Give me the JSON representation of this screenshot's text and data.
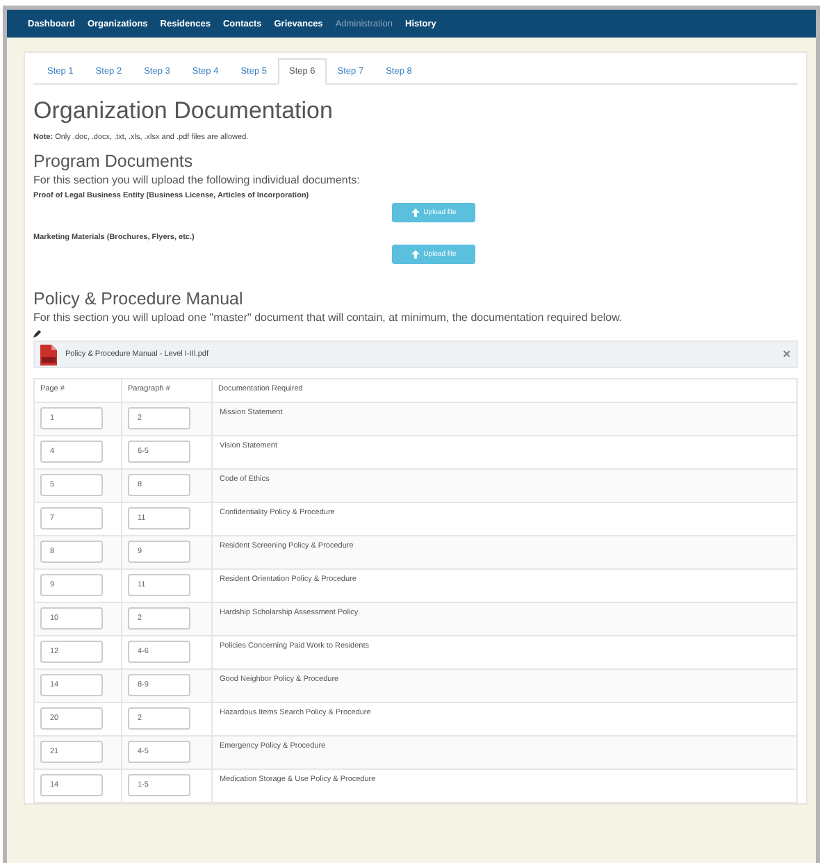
{
  "nav": [
    {
      "label": "Dashboard",
      "disabled": false
    },
    {
      "label": "Organizations",
      "disabled": false
    },
    {
      "label": "Residences",
      "disabled": false
    },
    {
      "label": "Contacts",
      "disabled": false
    },
    {
      "label": "Grievances",
      "disabled": false
    },
    {
      "label": "Administration",
      "disabled": true
    },
    {
      "label": "History",
      "disabled": false
    }
  ],
  "tabs": [
    {
      "label": "Step 1",
      "selected": false
    },
    {
      "label": "Step 2",
      "selected": false
    },
    {
      "label": "Step 3",
      "selected": false
    },
    {
      "label": "Step 4",
      "selected": false
    },
    {
      "label": "Step 5",
      "selected": false
    },
    {
      "label": "Step 6",
      "selected": true
    },
    {
      "label": "Step 7",
      "selected": false
    },
    {
      "label": "Step 8",
      "selected": false
    }
  ],
  "title": "Organization Documentation",
  "note": "**Note:** Only .doc, .docx, .txt, .xls, .xlsx and .pdf files are allowed.",
  "program_documents": {
    "heading": "Program Documents",
    "intro": "For this section you will upload the following individual documents:",
    "items": [
      {
        "label": "Proof of Legal Business Entity (Business License, Articles of Incorporation)",
        "button": "Upload file"
      },
      {
        "label": "Marketing Materials (Brochures, Flyers, etc.)",
        "button": "Upload file"
      }
    ]
  },
  "manual": {
    "heading": "Policy & Procedure Manual",
    "intro": "For this section you will upload one \"master\" document that will contain, at minimum, the documentation required below.",
    "file": {
      "name": "Policy & Procedure Manual - Level I-III.pdf",
      "close": "×"
    },
    "table": {
      "columns": [
        "Page #",
        "Paragraph #",
        "Documentation Required"
      ],
      "rows": [
        {
          "page": "1",
          "paragraph": "2",
          "doc": "Mission Statement"
        },
        {
          "page": "4",
          "paragraph": "6-5",
          "doc": "Vision Statement"
        },
        {
          "page": "5",
          "paragraph": "8",
          "doc": "Code of Ethics"
        },
        {
          "page": "7",
          "paragraph": "11",
          "doc": "Confidentiality Policy & Procedure"
        },
        {
          "page": "8",
          "paragraph": "9",
          "doc": "Resident Screening Policy & Procedure"
        },
        {
          "page": "9",
          "paragraph": "11",
          "doc": "Resident Orientation Policy & Procedure"
        },
        {
          "page": "10",
          "paragraph": "2",
          "doc": "Hardship Scholarship Assessment Policy"
        },
        {
          "page": "12",
          "paragraph": "4-6",
          "doc": "Policies Concerning Paid Work to Residents"
        },
        {
          "page": "14",
          "paragraph": "8-9",
          "doc": "Good Neighbor Policy & Procedure"
        },
        {
          "page": "20",
          "paragraph": "2",
          "doc": "Hazardous Items Search Policy & Procedure"
        },
        {
          "page": "21",
          "paragraph": "4-5",
          "doc": "Emergency Policy & Procedure"
        },
        {
          "page": "14",
          "paragraph": "1-5",
          "doc": "Medication Storage & Use Policy & Procedure"
        }
      ]
    }
  }
}
